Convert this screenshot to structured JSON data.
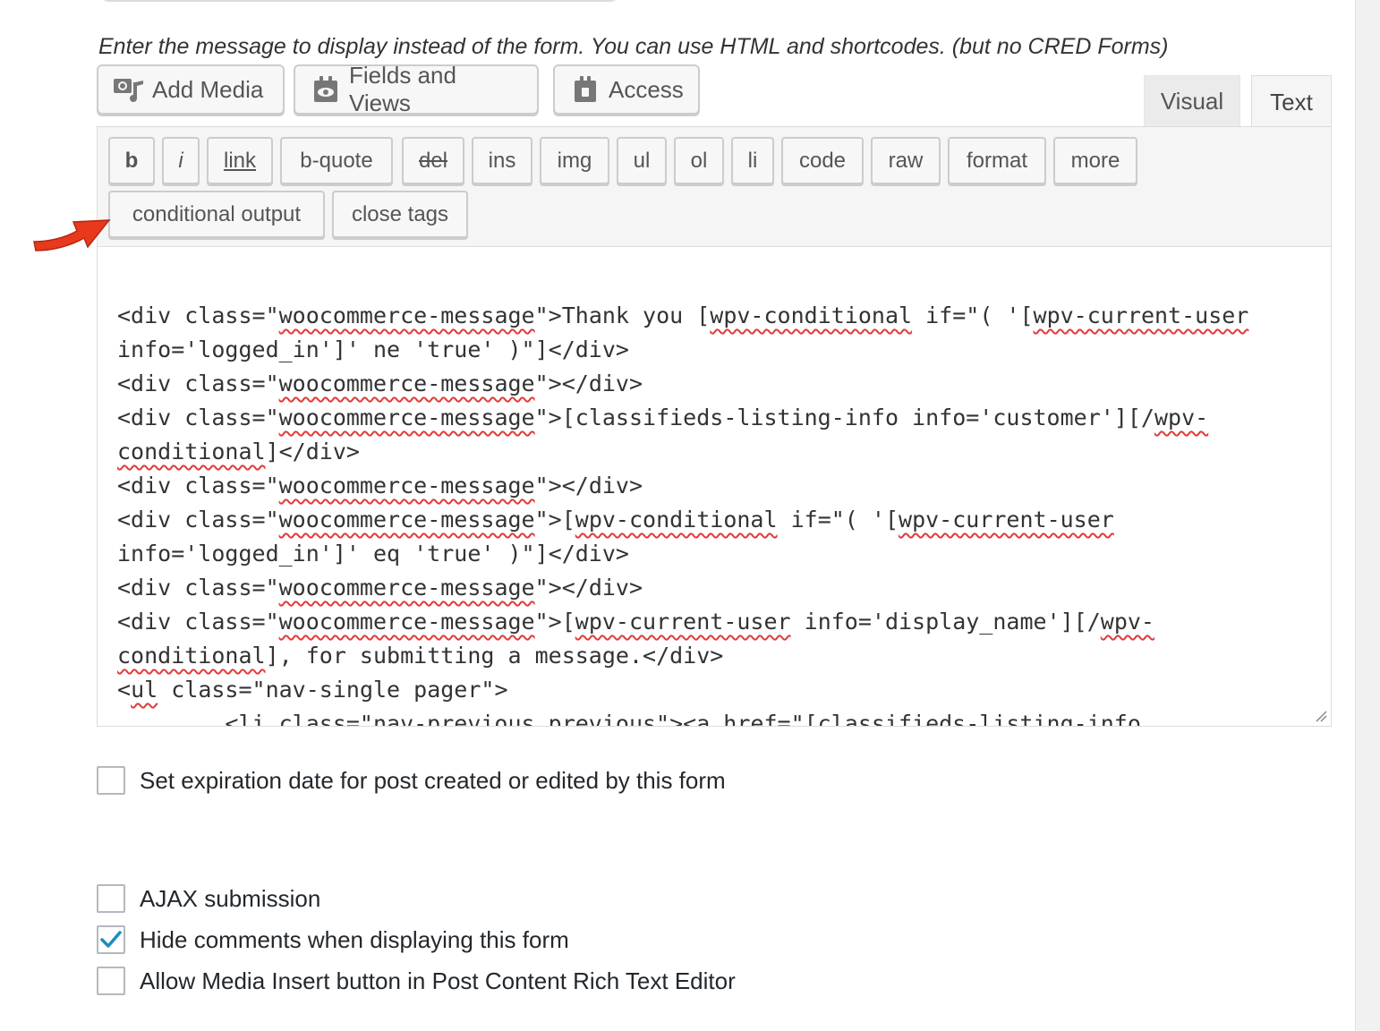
{
  "description": "Enter the message to display instead of the form. You can use HTML and shortcodes. (but no CRED Forms)",
  "media_buttons": [
    {
      "label": "Add Media",
      "icon": "add-media-icon"
    },
    {
      "label": "Fields and Views",
      "icon": "fields-views-icon"
    },
    {
      "label": "Access",
      "icon": "access-icon"
    }
  ],
  "editor_tabs": {
    "visual": "Visual",
    "text": "Text"
  },
  "quicktags": [
    "b",
    "i",
    "link",
    "b-quote",
    "del",
    "ins",
    "img",
    "ul",
    "ol",
    "li",
    "code",
    "raw",
    "format",
    "more",
    "conditional output",
    "close tags"
  ],
  "code_lines": [
    "<div class=\"woocommerce-message\">Thank you [wpv-conditional if=\"( '[wpv-current-user",
    "info='logged_in']' ne 'true' )\"]</div>",
    "<div class=\"woocommerce-message\"></div>",
    "<div class=\"woocommerce-message\">[classifieds-listing-info info='customer'][/wpv-",
    "conditional]</div>",
    "<div class=\"woocommerce-message\"></div>",
    "<div class=\"woocommerce-message\">[wpv-conditional if=\"( '[wpv-current-user",
    "info='logged_in']' eq 'true' )\"]</div>",
    "<div class=\"woocommerce-message\"></div>",
    "<div class=\"woocommerce-message\">[wpv-current-user info='display_name'][/wpv-",
    "conditional], for submitting a message.</div>",
    "<ul class=\"nav-single pager\">",
    "        <li class=\"nav-previous previous\"><a href=\"[classifieds-listing-info"
  ],
  "options": {
    "expiration": {
      "label": "Set expiration date for post created or edited by this form",
      "checked": false
    },
    "ajax": {
      "label": "AJAX submission",
      "checked": false
    },
    "hide_comments": {
      "label": "Hide comments when displaying this form",
      "checked": true
    },
    "allow_media": {
      "label": "Allow Media Insert button in Post Content Rich Text Editor",
      "checked": false
    }
  },
  "colors": {
    "accent": "#1e8cbe",
    "arrow": "#e8391d",
    "spellcheck": "#e03b3b"
  }
}
